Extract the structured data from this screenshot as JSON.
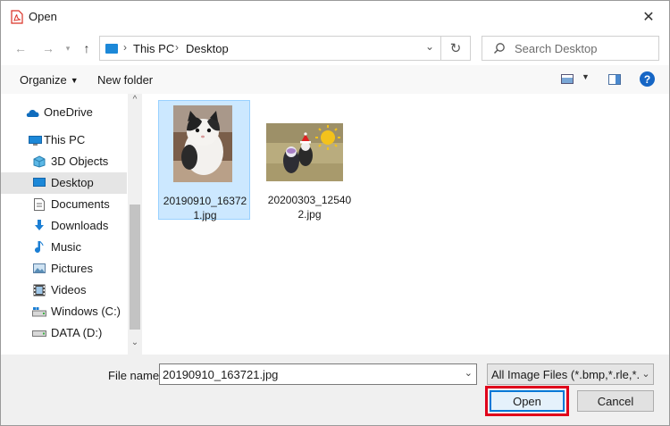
{
  "window": {
    "title": "Open"
  },
  "nav": {
    "breadcrumbs": [
      "This PC",
      "Desktop"
    ],
    "search_placeholder": "Search Desktop"
  },
  "toolbar": {
    "organize": "Organize",
    "new_folder": "New folder",
    "help": "?"
  },
  "sidebar": {
    "items": [
      {
        "label": "OneDrive",
        "icon": "cloud-icon"
      },
      {
        "label": "This PC",
        "icon": "computer-icon"
      },
      {
        "label": "3D Objects",
        "icon": "cube-icon"
      },
      {
        "label": "Desktop",
        "icon": "desktop-icon",
        "selected": true
      },
      {
        "label": "Documents",
        "icon": "document-icon"
      },
      {
        "label": "Downloads",
        "icon": "download-icon"
      },
      {
        "label": "Music",
        "icon": "music-icon"
      },
      {
        "label": "Pictures",
        "icon": "pictures-icon"
      },
      {
        "label": "Videos",
        "icon": "video-icon"
      },
      {
        "label": "Windows (C:)",
        "icon": "drive-windows-icon"
      },
      {
        "label": "DATA (D:)",
        "icon": "drive-icon"
      }
    ]
  },
  "files": [
    {
      "name": "20190910_163721.jpg",
      "line1": "20190910_16372",
      "line2": "1.jpg",
      "selected": true
    },
    {
      "name": "20200303_125402.jpg",
      "line1": "20200303_12540",
      "line2": "2.jpg",
      "selected": false
    }
  ],
  "bottom": {
    "file_name_label": "File name:",
    "file_name_value": "20190910_163721.jpg",
    "file_type": "All Image Files (*.bmp,*.rle,*.dib",
    "open_label": "Open",
    "cancel_label": "Cancel"
  },
  "colors": {
    "accent": "#0078d7",
    "selection": "#cce8ff",
    "highlight_box": "#e0001b"
  }
}
